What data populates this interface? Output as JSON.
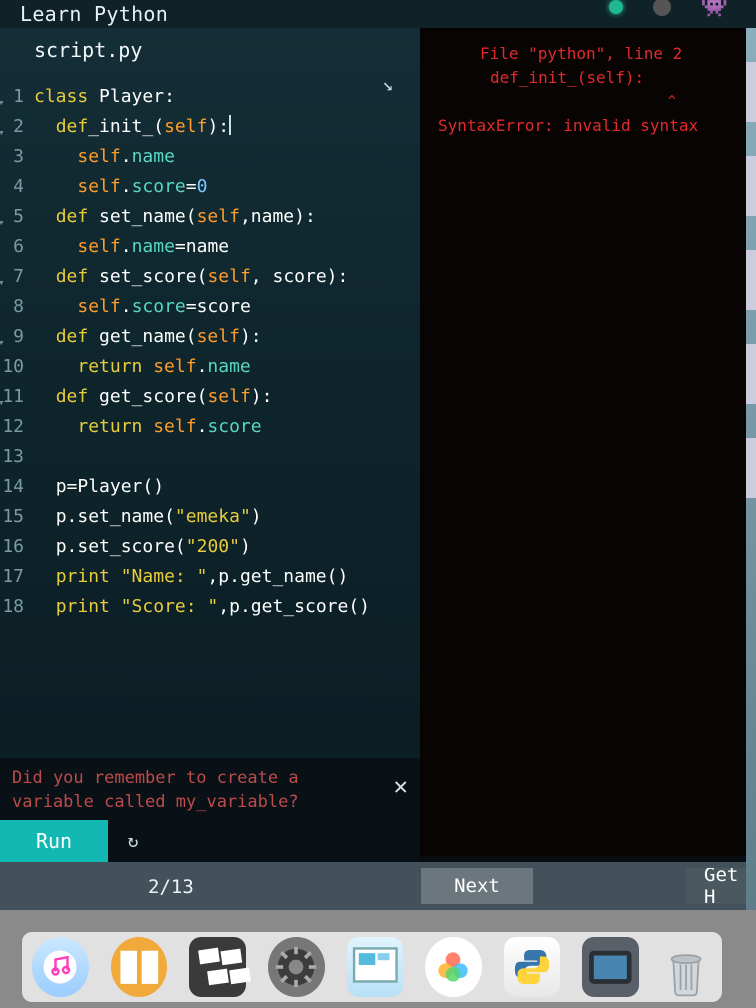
{
  "header": {
    "title": "Learn Python"
  },
  "editor": {
    "tab": "script.py",
    "expand_icon": "↗",
    "lines": [
      {
        "n": "1",
        "fold": true,
        "tokens": [
          [
            "kw",
            "class "
          ],
          [
            "fn",
            "Player"
          ],
          [
            "pun",
            ":"
          ]
        ]
      },
      {
        "n": "2",
        "fold": true,
        "tokens": [
          [
            "pun",
            "  "
          ],
          [
            "kw",
            "def"
          ],
          [
            "fn",
            "_init_"
          ],
          [
            "pun",
            "("
          ],
          [
            "slf",
            "self"
          ],
          [
            "pun",
            "):"
          ],
          [
            "cursor",
            ""
          ]
        ]
      },
      {
        "n": "3",
        "fold": false,
        "tokens": [
          [
            "pun",
            "    "
          ],
          [
            "slf",
            "self"
          ],
          [
            "pun",
            "."
          ],
          [
            "attr",
            "name"
          ]
        ]
      },
      {
        "n": "4",
        "fold": false,
        "tokens": [
          [
            "pun",
            "    "
          ],
          [
            "slf",
            "self"
          ],
          [
            "pun",
            "."
          ],
          [
            "attr",
            "score"
          ],
          [
            "pun",
            "="
          ],
          [
            "num",
            "0"
          ]
        ]
      },
      {
        "n": "5",
        "fold": true,
        "tokens": [
          [
            "pun",
            "  "
          ],
          [
            "kw",
            "def "
          ],
          [
            "fn",
            "set_name"
          ],
          [
            "pun",
            "("
          ],
          [
            "slf",
            "self"
          ],
          [
            "pun",
            ","
          ],
          [
            "fn",
            "name"
          ],
          [
            "pun",
            "):"
          ]
        ]
      },
      {
        "n": "6",
        "fold": false,
        "tokens": [
          [
            "pun",
            "    "
          ],
          [
            "slf",
            "self"
          ],
          [
            "pun",
            "."
          ],
          [
            "attr",
            "name"
          ],
          [
            "pun",
            "="
          ],
          [
            "fn",
            "name"
          ]
        ]
      },
      {
        "n": "7",
        "fold": true,
        "tokens": [
          [
            "pun",
            "  "
          ],
          [
            "kw",
            "def "
          ],
          [
            "fn",
            "set_score"
          ],
          [
            "pun",
            "("
          ],
          [
            "slf",
            "self"
          ],
          [
            "pun",
            ", "
          ],
          [
            "fn",
            "score"
          ],
          [
            "pun",
            "):"
          ]
        ]
      },
      {
        "n": "8",
        "fold": false,
        "tokens": [
          [
            "pun",
            "    "
          ],
          [
            "slf",
            "self"
          ],
          [
            "pun",
            "."
          ],
          [
            "attr",
            "score"
          ],
          [
            "pun",
            "="
          ],
          [
            "fn",
            "score"
          ]
        ]
      },
      {
        "n": "9",
        "fold": true,
        "tokens": [
          [
            "pun",
            "  "
          ],
          [
            "kw",
            "def "
          ],
          [
            "fn",
            "get_name"
          ],
          [
            "pun",
            "("
          ],
          [
            "slf",
            "self"
          ],
          [
            "pun",
            "):"
          ]
        ]
      },
      {
        "n": "10",
        "fold": false,
        "tokens": [
          [
            "pun",
            "    "
          ],
          [
            "kw",
            "return "
          ],
          [
            "slf",
            "self"
          ],
          [
            "pun",
            "."
          ],
          [
            "attr",
            "name"
          ]
        ]
      },
      {
        "n": "11",
        "fold": true,
        "tokens": [
          [
            "pun",
            "  "
          ],
          [
            "kw",
            "def "
          ],
          [
            "fn",
            "get_score"
          ],
          [
            "pun",
            "("
          ],
          [
            "slf",
            "self"
          ],
          [
            "pun",
            "):"
          ]
        ]
      },
      {
        "n": "12",
        "fold": false,
        "tokens": [
          [
            "pun",
            "    "
          ],
          [
            "kw",
            "return "
          ],
          [
            "slf",
            "self"
          ],
          [
            "pun",
            "."
          ],
          [
            "attr",
            "score"
          ]
        ]
      },
      {
        "n": "13",
        "fold": false,
        "tokens": []
      },
      {
        "n": "14",
        "fold": false,
        "tokens": [
          [
            "pun",
            "  "
          ],
          [
            "fn",
            "p"
          ],
          [
            "pun",
            "="
          ],
          [
            "fn",
            "Player"
          ],
          [
            "pun",
            "()"
          ]
        ]
      },
      {
        "n": "15",
        "fold": false,
        "tokens": [
          [
            "pun",
            "  "
          ],
          [
            "fn",
            "p"
          ],
          [
            "pun",
            "."
          ],
          [
            "fn",
            "set_name"
          ],
          [
            "pun",
            "("
          ],
          [
            "str",
            "\"emeka\""
          ],
          [
            "pun",
            ")"
          ]
        ]
      },
      {
        "n": "16",
        "fold": false,
        "tokens": [
          [
            "pun",
            "  "
          ],
          [
            "fn",
            "p"
          ],
          [
            "pun",
            "."
          ],
          [
            "fn",
            "set_score"
          ],
          [
            "pun",
            "("
          ],
          [
            "str",
            "\"200\""
          ],
          [
            "pun",
            ")"
          ]
        ]
      },
      {
        "n": "17",
        "fold": false,
        "tokens": [
          [
            "pun",
            "  "
          ],
          [
            "kw",
            "print "
          ],
          [
            "str",
            "\"Name: \""
          ],
          [
            "pun",
            ","
          ],
          [
            "fn",
            "p"
          ],
          [
            "pun",
            "."
          ],
          [
            "fn",
            "get_name"
          ],
          [
            "pun",
            "()"
          ]
        ]
      },
      {
        "n": "18",
        "fold": false,
        "tokens": [
          [
            "pun",
            "  "
          ],
          [
            "kw",
            "print "
          ],
          [
            "str",
            "\"Score: \""
          ],
          [
            "pun",
            ","
          ],
          [
            "fn",
            "p"
          ],
          [
            "pun",
            "."
          ],
          [
            "fn",
            "get_score"
          ],
          [
            "pun",
            "()"
          ]
        ]
      }
    ]
  },
  "console": {
    "l1": "File \"python\", line 2",
    "l2": "def_init_(self):",
    "caret": "^",
    "l3": "SyntaxError: invalid syntax"
  },
  "hint": {
    "text": "Did you remember to create a variable called my_variable?",
    "close": "✕"
  },
  "runbar": {
    "run": "Run",
    "reset": "↻"
  },
  "nav": {
    "progress": "2/13",
    "next": "Next",
    "gethelp": "Get H"
  },
  "dock": {
    "items": [
      "itunes",
      "ibooks",
      "photobooth",
      "settings",
      "preview",
      "photos",
      "python",
      "fcp",
      "trash"
    ]
  }
}
